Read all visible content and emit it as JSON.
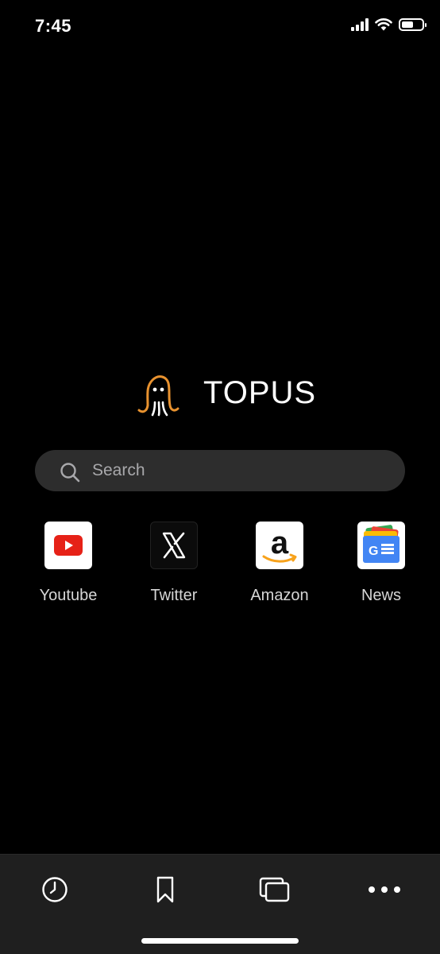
{
  "status_bar": {
    "time": "7:45",
    "battery_level": 0.6
  },
  "brand": {
    "title": "TOPUS",
    "logo_icon": "octopus-logo",
    "accent_color": "#e8922f"
  },
  "search": {
    "placeholder": "Search",
    "icon": "search-icon"
  },
  "shortcuts": [
    {
      "label": "Youtube",
      "icon": "youtube-icon"
    },
    {
      "label": "Twitter",
      "icon": "x-icon"
    },
    {
      "label": "Amazon",
      "icon": "amazon-icon"
    },
    {
      "label": "News",
      "icon": "google-news-icon"
    }
  ],
  "toolbar": {
    "items": [
      {
        "name": "history",
        "icon": "clock-icon"
      },
      {
        "name": "bookmarks",
        "icon": "bookmark-icon"
      },
      {
        "name": "tabs",
        "icon": "tabs-icon"
      },
      {
        "name": "more",
        "icon": "more-icon"
      }
    ]
  }
}
